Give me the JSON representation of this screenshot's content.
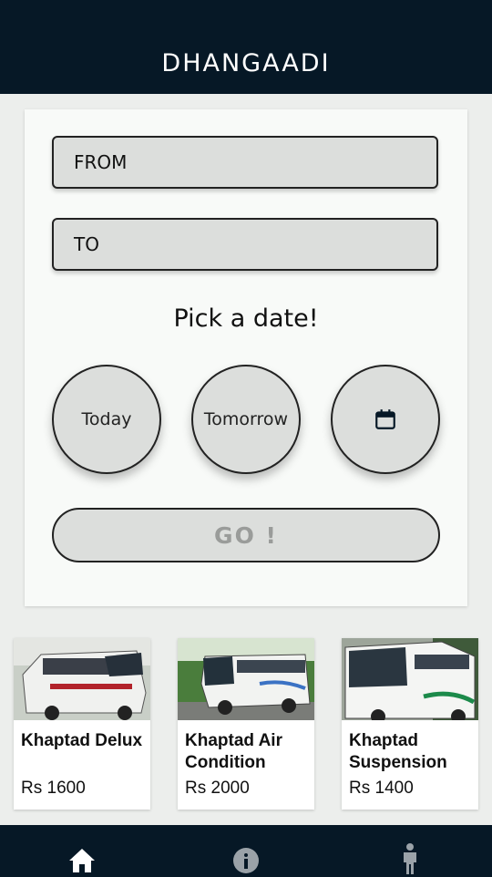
{
  "header": {
    "title": "DHANGAADI"
  },
  "search": {
    "from_placeholder": "FROM",
    "to_placeholder": "TO",
    "pick_date_label": "Pick a date!",
    "date_options": [
      "Today",
      "Tomorrow"
    ],
    "calendar_icon": "calendar-icon",
    "go_label": "GO !"
  },
  "buses": [
    {
      "name": "Khaptad Delux",
      "price": "Rs 1600"
    },
    {
      "name": "Khaptad Air Condition",
      "price": "Rs 2000"
    },
    {
      "name": "Khaptad Suspension",
      "price": "Rs 1400"
    }
  ],
  "bottom_nav": {
    "items": [
      "home-icon",
      "info-icon",
      "person-icon"
    ],
    "active": "home-icon"
  },
  "colors": {
    "bar": "#061826",
    "field": "#dcdedc",
    "background": "#eceeec"
  }
}
